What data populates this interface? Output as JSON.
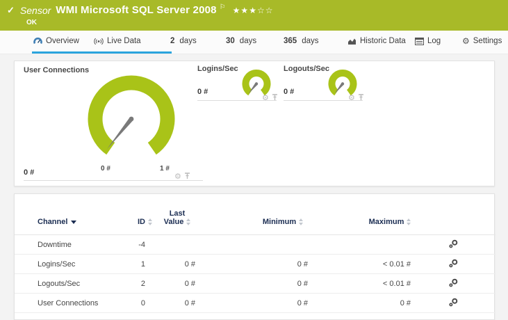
{
  "banner": {
    "check_icon": "✓",
    "kind_label": "Sensor",
    "title": "WMI Microsoft SQL Server 2008",
    "flag_icon": "⚐",
    "rating": "★★★☆☆",
    "status": "OK"
  },
  "tabs": {
    "overview": "Overview",
    "live_data": "Live Data",
    "days2_num": "2",
    "days2_unit": "days",
    "days30_num": "30",
    "days30_unit": "days",
    "days365_num": "365",
    "days365_unit": "days",
    "historic": "Historic Data",
    "log": "Log",
    "settings": "Settings",
    "gear_glyph": "⚙"
  },
  "gauges": {
    "user_connections": {
      "title": "User Connections",
      "current": "0 #",
      "min_label": "0 #",
      "max_label": "1 #",
      "value": 0,
      "min": 0,
      "max": 1
    },
    "logins": {
      "title": "Logins/Sec",
      "current": "0 #",
      "value": 0
    },
    "logouts": {
      "title": "Logouts/Sec",
      "current": "0 #",
      "value": 0
    },
    "gear_glyph": "⚙"
  },
  "table": {
    "headers": {
      "channel": "Channel",
      "id": "ID",
      "last_line1": "Last",
      "last_line2": "Value",
      "minimum": "Minimum",
      "maximum": "Maximum"
    },
    "rows": [
      {
        "channel": "Downtime",
        "id": "-4",
        "last": "",
        "min": "",
        "max": ""
      },
      {
        "channel": "Logins/Sec",
        "id": "1",
        "last": "0 #",
        "min": "0 #",
        "max": "< 0.01 #"
      },
      {
        "channel": "Logouts/Sec",
        "id": "2",
        "last": "0 #",
        "min": "0 #",
        "max": "< 0.01 #"
      },
      {
        "channel": "User Connections",
        "id": "0",
        "last": "0 #",
        "min": "0 #",
        "max": "0 #"
      }
    ]
  },
  "colors": {
    "banner_green": "#a8ba28",
    "gauge_green": "#a9c318",
    "active_tab_blue": "#2ba4dd",
    "table_header_navy": "#1b2d52"
  }
}
